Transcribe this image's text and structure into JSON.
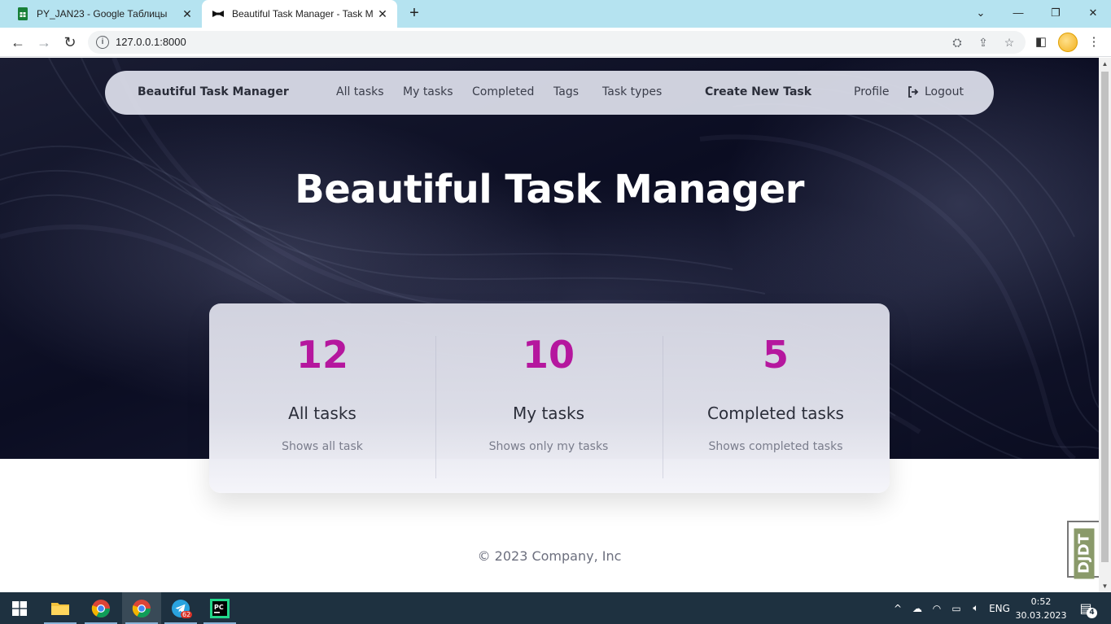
{
  "browser": {
    "tabs": [
      {
        "title": "PY_JAN23 - Google Таблицы",
        "icon": "sheets-icon",
        "active": false
      },
      {
        "title": "Beautiful Task Manager - Task Ma",
        "icon": "bowtie-icon",
        "active": true
      }
    ],
    "url": "127.0.0.1:8000",
    "accent": "#b5e3f0"
  },
  "page": {
    "nav": {
      "brand": "Beautiful Task Manager",
      "links": [
        "All tasks",
        "My tasks",
        "Completed",
        "Tags",
        "Task types"
      ],
      "create": "Create New Task",
      "profile": "Profile",
      "logout": "Logout"
    },
    "hero_title": "Beautiful Task Manager",
    "stats": [
      {
        "value": "12",
        "label": "All tasks",
        "description": "Shows all task"
      },
      {
        "value": "10",
        "label": "My tasks",
        "description": "Shows only my tasks"
      },
      {
        "value": "5",
        "label": "Completed tasks",
        "description": "Shows completed tasks"
      }
    ],
    "accent_color": "#b5179e",
    "footer": "© 2023 Company, Inc",
    "debug_toolbar": "DJDT"
  },
  "taskbar": {
    "apps": [
      "windows-start-icon",
      "file-explorer-icon",
      "chrome-icon",
      "chrome-icon",
      "telegram-icon",
      "pycharm-icon"
    ],
    "telegram_badge": "62",
    "language": "ENG",
    "time": "0:52",
    "date": "30.03.2023",
    "notifications": "4"
  }
}
